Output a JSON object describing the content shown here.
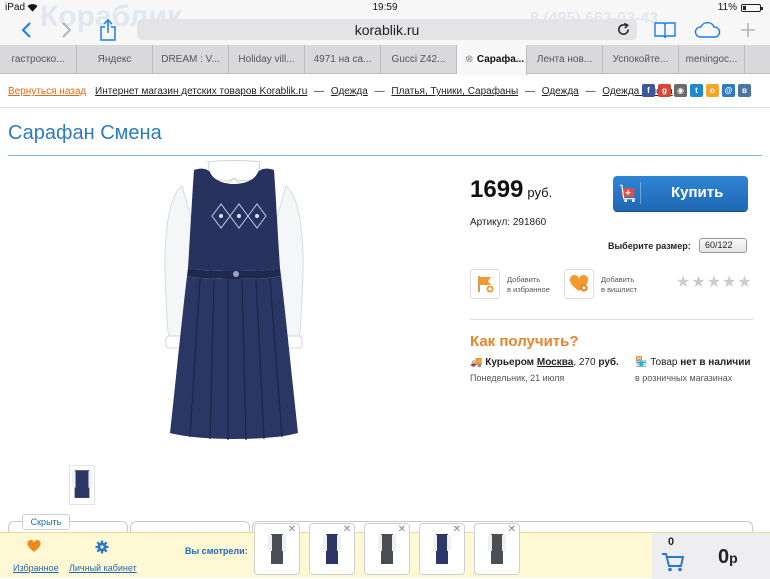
{
  "status_bar": {
    "carrier": "iPad",
    "time": "19:59",
    "battery": "11%"
  },
  "browser": {
    "url": "korablik.ru",
    "tabs": [
      {
        "label": "гастроско..."
      },
      {
        "label": "Яндекс"
      },
      {
        "label": "DREAM : V..."
      },
      {
        "label": "Holiday vill..."
      },
      {
        "label": "4971 на са..."
      },
      {
        "label": "Gucci Z42..."
      },
      {
        "label": "Сарафа...",
        "active": true
      },
      {
        "label": "Лента нов..."
      },
      {
        "label": "Успокойте..."
      },
      {
        "label": "meningoc..."
      }
    ],
    "new_tab_label": "+"
  },
  "breadcrumb": {
    "back": "Вернуться назад",
    "items": [
      "Интернет магазин детских товаров Korablik.ru",
      "Одежда",
      "Платья, Туники, Сарафаны",
      "Одежда",
      "Одежда Смена"
    ],
    "separator": "—",
    "more": "→"
  },
  "product": {
    "title": "Сарафан Смена",
    "price": "1699",
    "currency": "руб.",
    "sku": "Артикул: 291860",
    "buy_label": "Купить",
    "size_label": "Выберите размер:",
    "size_value": "60/122",
    "favorites": [
      "Добавить",
      "в избранное"
    ],
    "wishlist": [
      "Добавить",
      "в вишлист"
    ],
    "rating_stars": 5,
    "rating_value": 0
  },
  "delivery": {
    "heading": "Как получить?",
    "courier_prefix": "Курьером",
    "courier_city": "Москва",
    "courier_price": ", 270",
    "courier_currency": "руб.",
    "courier_date": "Понедельник, 21 июля",
    "store_prefix": "Товар",
    "store_status": "нет в наличии",
    "store_sub": "в розничных магазинах"
  },
  "bottom_panel": {
    "hide": "Скрыть",
    "favorites": "Избранное",
    "account": "Личный кабинет",
    "viewed_label": "Вы смотрели:",
    "cart_count": "0",
    "cart_total": "0",
    "cart_currency": "р"
  },
  "colors": {
    "accent_blue": "#2e7bc0",
    "link_blue": "#1d6ab4",
    "orange": "#e6852a",
    "dress_navy": "#27325e"
  }
}
